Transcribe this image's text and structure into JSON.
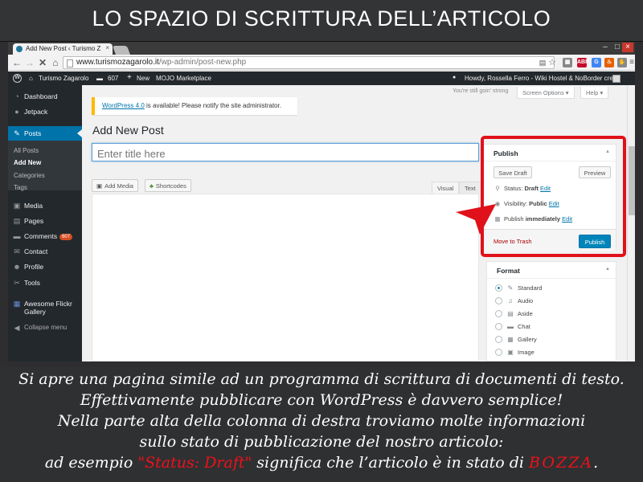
{
  "banner": {
    "title": "LO SPAZIO DI SCRITTURA DELL’ARTICOLO"
  },
  "browser": {
    "tab_title": "Add New Post ‹ Turismo Z",
    "url_host": "www.turismozagarolo.it",
    "url_path": "/wp-admin/post-new.php",
    "extensions": [
      "ABP",
      "translate",
      "flame",
      "hand",
      "menu"
    ]
  },
  "adminbar": {
    "site_name": "Turismo Zagarolo",
    "comments_count": "607",
    "new_label": "New",
    "marketplace": "MOJO Marketplace",
    "howdy": "Howdy, Rossella Ferro - Wiki Hostel & NoBorder crew"
  },
  "sidebar": {
    "items": [
      {
        "label": "Dashboard",
        "icon": "dashboard-icon"
      },
      {
        "label": "Jetpack",
        "icon": "jetpack-icon"
      },
      {
        "label": "Posts",
        "icon": "pin-icon"
      },
      {
        "label": "Media",
        "icon": "media-icon"
      },
      {
        "label": "Pages",
        "icon": "pages-icon"
      },
      {
        "label": "Comments",
        "icon": "comments-icon",
        "badge": "607"
      },
      {
        "label": "Contact",
        "icon": "contact-icon"
      },
      {
        "label": "Profile",
        "icon": "profile-icon"
      },
      {
        "label": "Tools",
        "icon": "tools-icon"
      },
      {
        "label": "Awesome Flickr Gallery",
        "icon": "flickr-icon"
      },
      {
        "label": "Collapse menu",
        "icon": "collapse-icon"
      }
    ],
    "submenu": [
      "All Posts",
      "Add New",
      "Categories",
      "Tags"
    ]
  },
  "header": {
    "tagline": "You're still goin' strong",
    "screen_options": "Screen Options ▾",
    "help": "Help ▾"
  },
  "notice": {
    "link": "WordPress 4.0",
    "text": " is available! Please notify the site administrator."
  },
  "page": {
    "title": "Add New Post",
    "title_placeholder": "Enter title here",
    "add_media": "Add Media",
    "shortcodes": "Shortcodes",
    "tab_visual": "Visual",
    "tab_text": "Text"
  },
  "publish": {
    "heading": "Publish",
    "save_draft": "Save Draft",
    "preview": "Preview",
    "status_label": "Status: ",
    "status_value": "Draft",
    "visibility_label": "Visibility: ",
    "visibility_value": "Public",
    "publish_label": "Publish ",
    "publish_value": "immediately",
    "edit": "Edit",
    "trash": "Move to Trash",
    "publish_button": "Publish"
  },
  "format": {
    "heading": "Format",
    "options": [
      {
        "label": "Standard",
        "icon": "pin-icon",
        "checked": true
      },
      {
        "label": "Audio",
        "icon": "audio-icon",
        "checked": false
      },
      {
        "label": "Aside",
        "icon": "aside-icon",
        "checked": false
      },
      {
        "label": "Chat",
        "icon": "chat-icon",
        "checked": false
      },
      {
        "label": "Gallery",
        "icon": "gallery-icon",
        "checked": false
      },
      {
        "label": "Image",
        "icon": "image-icon",
        "checked": false
      }
    ]
  },
  "caption": {
    "line1": "Si apre una pagina simile ad un programma di scrittura di documenti di testo.",
    "line2": "Effettivamente pubblicare con WordPress è davvero semplice!",
    "line3": "Nella parte alta della colonna di destra troviamo molte informazioni",
    "line4": "sullo stato di pubblicazione del nostro articolo:",
    "line5_pre": "ad esempio ",
    "line5_red1": "\"Status: Draft\"",
    "line5_mid": " significa che l’articolo è in stato di ",
    "line5_red2": "BOZZA",
    "line5_post": "."
  },
  "colors": {
    "highlight": "#e0111a",
    "wp_blue": "#0073aa",
    "admin_dark": "#23282d"
  }
}
